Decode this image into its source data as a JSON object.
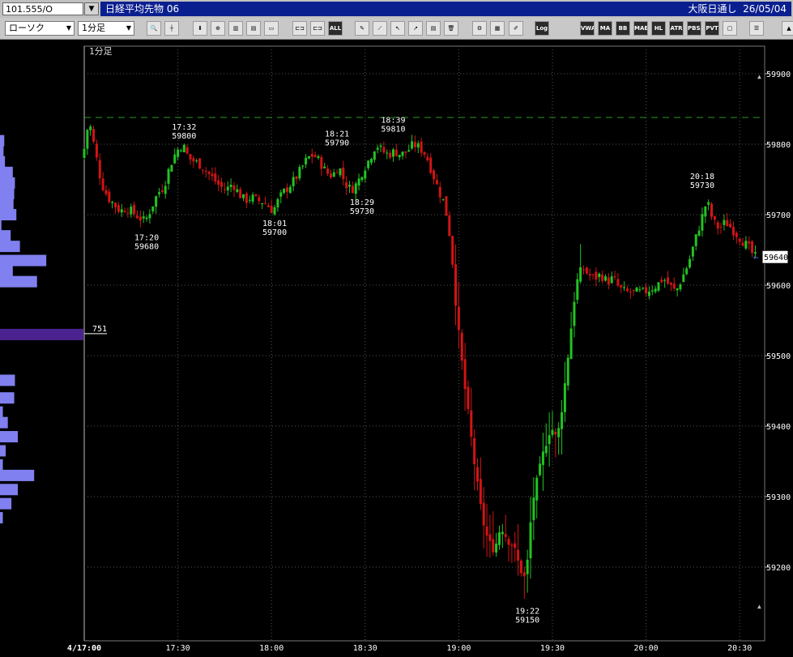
{
  "symbol": {
    "value": "101.555/O",
    "dropdown_icon": "chevron-down-icon"
  },
  "title": {
    "instrument": "日経平均先物 06",
    "session": "大阪日通し",
    "date": "26/05/04"
  },
  "toolbar": {
    "chart_type": "ローソク",
    "interval": "1分足",
    "buttons": [
      {
        "name": "zoom-icon",
        "label": "🔍"
      },
      {
        "name": "crosshair-icon",
        "label": "┼"
      },
      {
        "name": "download-icon",
        "label": "⬇"
      },
      {
        "name": "magnifier-icon",
        "label": "⊕"
      },
      {
        "name": "bar-chart-icon",
        "label": "▥"
      },
      {
        "name": "bar-chart-red-icon",
        "label": "▤"
      },
      {
        "name": "disabled-icon",
        "label": "▭"
      },
      {
        "name": "candle-compare-icon",
        "label": "⊏⊐"
      },
      {
        "name": "candle-select-icon",
        "label": "⊏⊐"
      },
      {
        "name": "all-icon",
        "label": "ALL"
      },
      {
        "name": "pencil-icon",
        "label": "✎"
      },
      {
        "name": "line-tool-icon",
        "label": "⟋"
      },
      {
        "name": "cursor-icon",
        "label": "↖"
      },
      {
        "name": "arrow-icon",
        "label": "↗"
      },
      {
        "name": "note-icon",
        "label": "▤"
      },
      {
        "name": "trash-icon",
        "label": "🗑"
      },
      {
        "name": "settings-icon",
        "label": "⚙"
      },
      {
        "name": "palette-icon",
        "label": "▦"
      },
      {
        "name": "log-icon",
        "label": "Log"
      },
      {
        "name": "brush-icon",
        "label": "✐"
      },
      {
        "name": "vwap-button",
        "label": "VWAP"
      },
      {
        "name": "ma-button",
        "label": "MA"
      },
      {
        "name": "bb-button",
        "label": "BB"
      },
      {
        "name": "mae-button",
        "label": "MAE"
      },
      {
        "name": "hl-button",
        "label": "HL"
      },
      {
        "name": "atr-button",
        "label": "ATR"
      },
      {
        "name": "pbsa-button",
        "label": "PBSA"
      },
      {
        "name": "pvt-button",
        "label": "PVT"
      },
      {
        "name": "window-button",
        "label": "▢"
      },
      {
        "name": "list-icon",
        "label": "☰"
      },
      {
        "name": "scroll-up-icon",
        "label": "▲"
      }
    ]
  },
  "chart_data": {
    "type": "candlestick",
    "interval_label": "1分足",
    "ylim": [
      59150,
      59900
    ],
    "y_ticks": [
      "59900",
      "59800",
      "59700",
      "59600",
      "59500",
      "59400",
      "59300",
      "59200"
    ],
    "x_ticks": [
      "4/17:00",
      "17:30",
      "18:00",
      "18:30",
      "19:00",
      "19:30",
      "20:00",
      "20:30"
    ],
    "current_price": "59640",
    "reference_level": 59838,
    "volume_profile_label": "751",
    "annotations": [
      {
        "time": "17:20",
        "price": "59680"
      },
      {
        "time": "17:32",
        "price": "59800"
      },
      {
        "time": "18:01",
        "price": "59700"
      },
      {
        "time": "18:21",
        "price": "59790"
      },
      {
        "time": "18:29",
        "price": "59730"
      },
      {
        "time": "18:39",
        "price": "59810"
      },
      {
        "time": "19:22",
        "price": "59150"
      },
      {
        "time": "20:18",
        "price": "59730"
      }
    ],
    "price_path": [
      [
        0,
        59780
      ],
      [
        2,
        59835
      ],
      [
        4,
        59790
      ],
      [
        6,
        59745
      ],
      [
        8,
        59725
      ],
      [
        10,
        59715
      ],
      [
        12,
        59705
      ],
      [
        14,
        59710
      ],
      [
        17,
        59700
      ],
      [
        20,
        59690
      ],
      [
        22,
        59710
      ],
      [
        24,
        59730
      ],
      [
        26,
        59740
      ],
      [
        28,
        59770
      ],
      [
        30,
        59790
      ],
      [
        32,
        59800
      ],
      [
        34,
        59780
      ],
      [
        36,
        59775
      ],
      [
        38,
        59770
      ],
      [
        40,
        59760
      ],
      [
        42,
        59750
      ],
      [
        44,
        59740
      ],
      [
        46,
        59735
      ],
      [
        48,
        59745
      ],
      [
        50,
        59730
      ],
      [
        52,
        59720
      ],
      [
        54,
        59725
      ],
      [
        56,
        59720
      ],
      [
        58,
        59718
      ],
      [
        60,
        59710
      ],
      [
        61,
        59705
      ],
      [
        62,
        59715
      ],
      [
        64,
        59730
      ],
      [
        66,
        59740
      ],
      [
        68,
        59750
      ],
      [
        70,
        59765
      ],
      [
        72,
        59780
      ],
      [
        74,
        59785
      ],
      [
        76,
        59775
      ],
      [
        78,
        59760
      ],
      [
        80,
        59755
      ],
      [
        82,
        59770
      ],
      [
        84,
        59745
      ],
      [
        86,
        59735
      ],
      [
        88,
        59745
      ],
      [
        90,
        59765
      ],
      [
        92,
        59780
      ],
      [
        94,
        59800
      ],
      [
        96,
        59790
      ],
      [
        98,
        59785
      ],
      [
        100,
        59790
      ],
      [
        102,
        59785
      ],
      [
        104,
        59790
      ],
      [
        106,
        59800
      ],
      [
        108,
        59795
      ],
      [
        110,
        59785
      ],
      [
        112,
        59760
      ],
      [
        114,
        59735
      ],
      [
        116,
        59715
      ],
      [
        118,
        59660
      ],
      [
        120,
        59550
      ],
      [
        122,
        59470
      ],
      [
        124,
        59400
      ],
      [
        126,
        59330
      ],
      [
        128,
        59270
      ],
      [
        130,
        59235
      ],
      [
        132,
        59225
      ],
      [
        134,
        59260
      ],
      [
        136,
        59240
      ],
      [
        138,
        59230
      ],
      [
        140,
        59200
      ],
      [
        142,
        59180
      ],
      [
        144,
        59290
      ],
      [
        146,
        59330
      ],
      [
        148,
        59370
      ],
      [
        150,
        59400
      ],
      [
        152,
        59380
      ],
      [
        154,
        59440
      ],
      [
        156,
        59520
      ],
      [
        158,
        59600
      ],
      [
        160,
        59625
      ],
      [
        162,
        59615
      ],
      [
        164,
        59610
      ],
      [
        166,
        59615
      ],
      [
        168,
        59605
      ],
      [
        170,
        59610
      ],
      [
        172,
        59595
      ],
      [
        174,
        59590
      ],
      [
        176,
        59590
      ],
      [
        178,
        59590
      ],
      [
        180,
        59590
      ],
      [
        182,
        59595
      ],
      [
        184,
        59600
      ],
      [
        186,
        59610
      ],
      [
        188,
        59600
      ],
      [
        190,
        59590
      ],
      [
        192,
        59610
      ],
      [
        194,
        59630
      ],
      [
        196,
        59660
      ],
      [
        198,
        59690
      ],
      [
        200,
        59720
      ],
      [
        202,
        59690
      ],
      [
        204,
        59680
      ],
      [
        206,
        59690
      ],
      [
        208,
        59680
      ],
      [
        210,
        59670
      ],
      [
        212,
        59660
      ],
      [
        214,
        59650
      ],
      [
        215,
        59640
      ]
    ],
    "volume_profile": [
      {
        "price": 59805,
        "volume": 60
      },
      {
        "price": 59790,
        "volume": 50
      },
      {
        "price": 59775,
        "volume": 70
      },
      {
        "price": 59760,
        "volume": 180
      },
      {
        "price": 59745,
        "volume": 210
      },
      {
        "price": 59730,
        "volume": 200
      },
      {
        "price": 59715,
        "volume": 190
      },
      {
        "price": 59700,
        "volume": 230
      },
      {
        "price": 59685,
        "volume": 20
      },
      {
        "price": 59670,
        "volume": 150
      },
      {
        "price": 59655,
        "volume": 280
      },
      {
        "price": 59635,
        "volume": 650
      },
      {
        "price": 59620,
        "volume": 180
      },
      {
        "price": 59605,
        "volume": 520
      },
      {
        "price": 59530,
        "volume": 751
      },
      {
        "price": 59465,
        "volume": 210
      },
      {
        "price": 59440,
        "volume": 200
      },
      {
        "price": 59420,
        "volume": 40
      },
      {
        "price": 59405,
        "volume": 110
      },
      {
        "price": 59385,
        "volume": 250
      },
      {
        "price": 59365,
        "volume": 80
      },
      {
        "price": 59345,
        "volume": 40
      },
      {
        "price": 59330,
        "volume": 480
      },
      {
        "price": 59310,
        "volume": 250
      },
      {
        "price": 59290,
        "volume": 160
      },
      {
        "price": 59270,
        "volume": 40
      }
    ],
    "colors": {
      "up": "#22c322",
      "down": "#d21414",
      "grid": "#555555",
      "profile": "#8080f0",
      "profile_peak": "#4b2390",
      "reference": "#2a9a2a",
      "axis_text": "#ffffff"
    }
  }
}
